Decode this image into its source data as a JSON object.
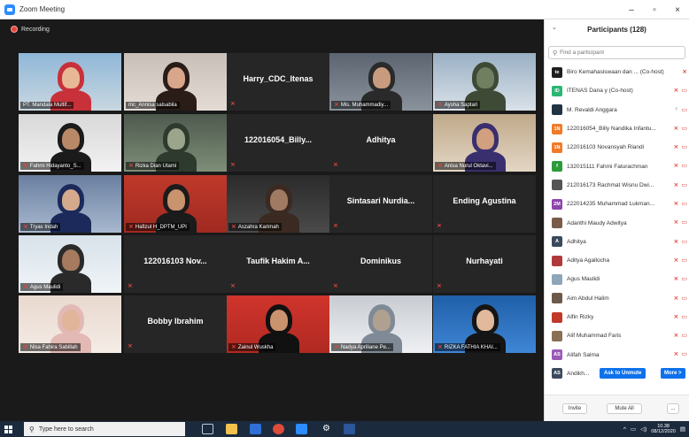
{
  "window": {
    "title": "Zoom Meeting",
    "controls": {
      "minimize": "–",
      "maximize": "▫",
      "close": "×"
    }
  },
  "recording_label": "Recording",
  "video_tiles": [
    {
      "name": "PT. Mandala Multif...",
      "type": "video",
      "active": true,
      "muted": false
    },
    {
      "name": "mc_Annisa salsabila",
      "type": "video",
      "muted": false
    },
    {
      "name": "Harry_CDC_Itenas",
      "type": "name",
      "muted": true
    },
    {
      "name": "Mis. Muhammadiy...",
      "type": "video",
      "muted": true
    },
    {
      "name": "Aysha Saptari",
      "type": "video",
      "muted": true
    },
    {
      "name": "Fahmi Hidayanto_S...",
      "type": "video",
      "muted": true
    },
    {
      "name": "Rizka Dian Utami",
      "type": "video",
      "muted": true
    },
    {
      "name": "122016054_Billy...",
      "type": "name",
      "muted": true
    },
    {
      "name": "Adhitya",
      "type": "name",
      "muted": true
    },
    {
      "name": "Anisa Nurul Oktavi...",
      "type": "video",
      "muted": true
    },
    {
      "name": "Tryas Indah",
      "type": "video",
      "muted": true
    },
    {
      "name": "Hafizul H_DPTM_UPI",
      "type": "video",
      "muted": true
    },
    {
      "name": "Aszahra Karimah",
      "type": "video",
      "muted": true
    },
    {
      "name": "Sintasari Nurdia...",
      "type": "name",
      "muted": true
    },
    {
      "name": "Ending Agustina",
      "type": "name",
      "muted": true
    },
    {
      "name": "Agus Maulidi",
      "type": "video",
      "muted": true
    },
    {
      "name": "122016103 Nov...",
      "type": "name",
      "muted": true
    },
    {
      "name": "Taufik Hakim A...",
      "type": "name",
      "muted": true
    },
    {
      "name": "Dominikus",
      "type": "name",
      "muted": true
    },
    {
      "name": "Nurhayati",
      "type": "name",
      "muted": true
    },
    {
      "name": "Nisa Fahira Sabillah",
      "type": "video",
      "muted": true
    },
    {
      "name": "Bobby Ibrahim",
      "type": "name",
      "muted": true
    },
    {
      "name": "Zainul Wuskha",
      "type": "video",
      "muted": true
    },
    {
      "name": "Nadya Apriliane Pe...",
      "type": "video",
      "muted": true
    },
    {
      "name": "RIZKA FATHIA KHAI...",
      "type": "video",
      "muted": true
    }
  ],
  "participants_panel": {
    "title": "Participants (128)",
    "search_placeholder": "Find a participant",
    "participants": [
      {
        "initials": "te",
        "name": "Biro Kemahasiswaan dan ... (Co-host)",
        "avatar_color": "#1e1e1e",
        "video_off": false
      },
      {
        "initials": "ID",
        "name": "ITENAS Dana y (Co-host)",
        "avatar_color": "#2bb673",
        "video_off": true
      },
      {
        "initials": "",
        "name": "M. Revaldi Anggara",
        "avatar_color": "#223344",
        "mic_gray": true,
        "video_off": true
      },
      {
        "initials": "1N",
        "name": "122016054_Billy Nandika Infantu...",
        "avatar_color": "#f07a28",
        "video_off": true
      },
      {
        "initials": "1N",
        "name": "122016103 Novansyah Riandi",
        "avatar_color": "#f07a28",
        "video_off": true
      },
      {
        "initials": "f",
        "name": "132015111 Fahmi Faturachman",
        "avatar_color": "#2d9a3a",
        "video_off": true
      },
      {
        "initials": "",
        "name": "212016173 Rachmat Wisnu Dwi...",
        "avatar_color": "#555555",
        "video_off": true
      },
      {
        "initials": "2M",
        "name": "222014235 Muhammad Lukman...",
        "avatar_color": "#8e44ad",
        "video_off": true
      },
      {
        "initials": "",
        "name": "Adanthi Maudy Adwitya",
        "avatar_color": "#7a5b48",
        "video_off": true
      },
      {
        "initials": "A",
        "name": "Adhitya",
        "avatar_color": "#3b4a5c",
        "video_off": true
      },
      {
        "initials": "",
        "name": "Aditya Agallocha",
        "avatar_color": "#b03a3a",
        "video_off": true
      },
      {
        "initials": "",
        "name": "Agus Maulidi",
        "avatar_color": "#8fa5b8",
        "video_off": true
      },
      {
        "initials": "",
        "name": "Aim Abdul Halim",
        "avatar_color": "#6d5a4a",
        "video_off": true
      },
      {
        "initials": "",
        "name": "Alfin Rizky",
        "avatar_color": "#c0392b",
        "video_off": true
      },
      {
        "initials": "",
        "name": "Alif Muhammad Faris",
        "avatar_color": "#8a6f55",
        "video_off": true
      },
      {
        "initials": "AS",
        "name": "Alifah Salma",
        "avatar_color": "#9b59b6",
        "video_off": true
      },
      {
        "initials": "AS",
        "name": "Andikh...",
        "avatar_color": "#3b4a5c",
        "actions": true
      }
    ],
    "ask_to_unmute": "Ask to Unmute",
    "more": "More >",
    "invite": "Invite",
    "mute_all": "Mute All",
    "more_dots": "..."
  },
  "taskbar": {
    "search_placeholder": "Type here to search",
    "time": "10.38",
    "date": "08/12/2020"
  }
}
